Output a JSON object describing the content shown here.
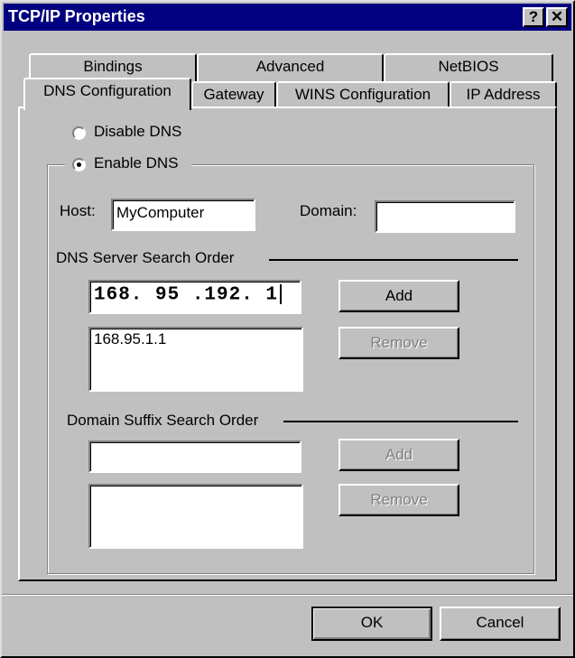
{
  "window": {
    "title": "TCP/IP Properties",
    "help_btn": "?",
    "close_btn": "✕"
  },
  "tabs": {
    "back_row": [
      "Bindings",
      "Advanced",
      "NetBIOS"
    ],
    "front_row": [
      "DNS Configuration",
      "Gateway",
      "WINS Configuration",
      "IP Address"
    ],
    "active": "DNS Configuration"
  },
  "dns": {
    "disable_label": "Disable DNS",
    "enable_label": "Enable DNS",
    "enable_selected": true,
    "host_label": "Host:",
    "host_value": "MyComputer",
    "domain_label": "Domain:",
    "domain_value": "",
    "server_order_label": "DNS Server Search Order",
    "server_input": "168. 95 .192. 1",
    "server_list": [
      "168.95.1.1"
    ],
    "add_label": "Add",
    "remove_label": "Remove",
    "suffix_order_label": "Domain Suffix Search Order",
    "suffix_input": "",
    "suffix_list": [],
    "suffix_add_label": "Add",
    "suffix_remove_label": "Remove"
  },
  "footer": {
    "ok_label": "OK",
    "cancel_label": "Cancel"
  }
}
